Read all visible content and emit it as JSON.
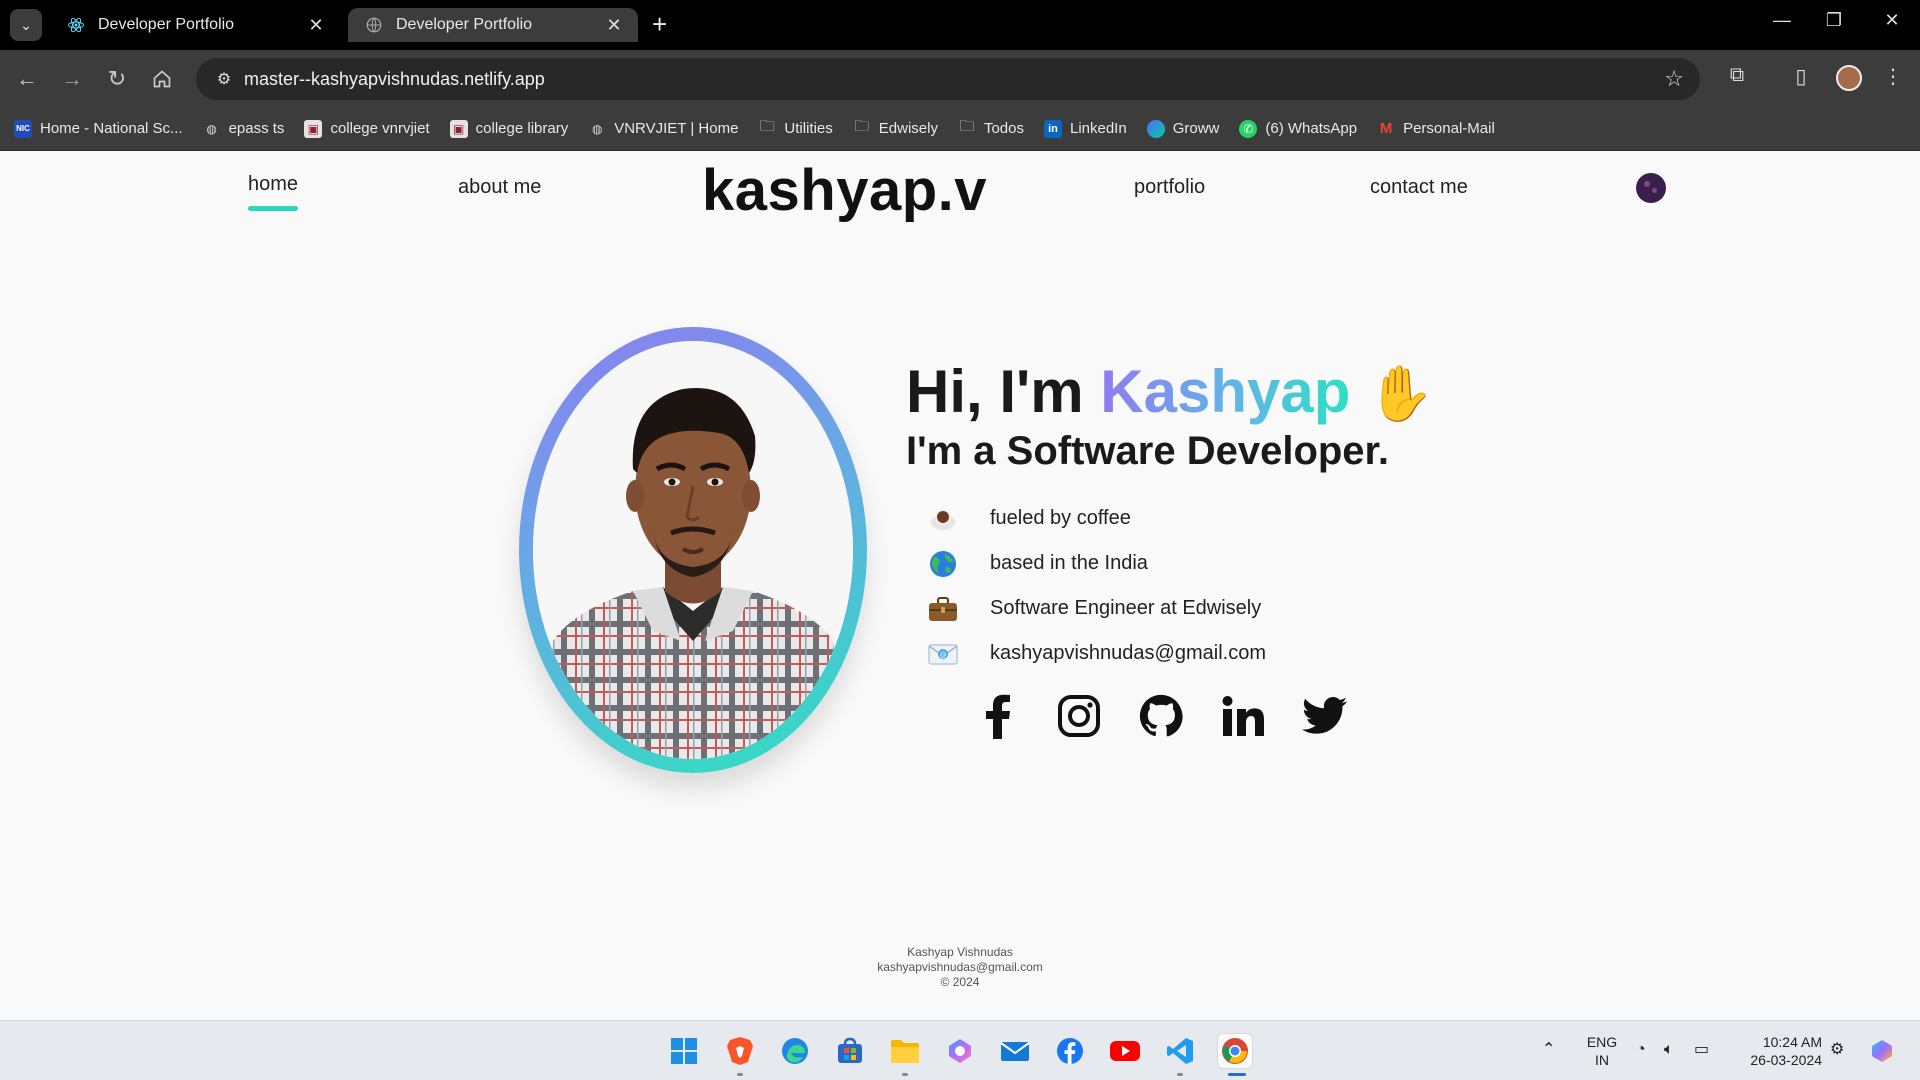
{
  "browser": {
    "tabs": [
      {
        "title": "Developer Portfolio",
        "active": false
      },
      {
        "title": "Developer Portfolio",
        "active": true
      }
    ],
    "url": "master--kashyapvishnudas.netlify.app",
    "bookmarks": [
      {
        "label": "Home - National Sc...",
        "icon": "nic-icon"
      },
      {
        "label": "epass ts",
        "icon": "globe-icon"
      },
      {
        "label": "college vnrvjiet",
        "icon": "college-icon"
      },
      {
        "label": "college library",
        "icon": "college-icon"
      },
      {
        "label": "VNRVJIET | Home",
        "icon": "globe-icon"
      },
      {
        "label": "Utilities",
        "icon": "folder-icon"
      },
      {
        "label": "Edwisely",
        "icon": "folder-icon"
      },
      {
        "label": "Todos",
        "icon": "folder-icon"
      },
      {
        "label": "LinkedIn",
        "icon": "linkedin-icon"
      },
      {
        "label": "Groww",
        "icon": "groww-icon"
      },
      {
        "label": "(6) WhatsApp",
        "icon": "whatsapp-icon"
      },
      {
        "label": "Personal-Mail",
        "icon": "gmail-icon"
      }
    ]
  },
  "nav": {
    "home": "home",
    "about": "about me",
    "brand": "kashyap.v",
    "portfolio": "portfolio",
    "contact": "contact me"
  },
  "hero": {
    "greeting": "Hi, I'm ",
    "name": "Kashyap",
    "wave": "✋",
    "subtitle": "I'm a Software Developer."
  },
  "facts": [
    {
      "icon": "coffee-icon",
      "text": "fueled by coffee"
    },
    {
      "icon": "globe-icon",
      "text": "based in the India"
    },
    {
      "icon": "briefcase-icon",
      "text": "Software Engineer at Edwisely"
    },
    {
      "icon": "email-icon",
      "text": "kashyapvishnudas@gmail.com"
    }
  ],
  "socials": [
    "facebook-icon",
    "instagram-icon",
    "github-icon",
    "linkedin-icon",
    "twitter-icon"
  ],
  "footer": {
    "name": "Kashyap Vishnudas",
    "email": "kashyapvishnudas@gmail.com",
    "copyright": "© 2024"
  },
  "taskbar": {
    "lang_top": "ENG",
    "lang_bottom": "IN",
    "time": "10:24 AM",
    "date": "26-03-2024"
  },
  "colors": {
    "accent_teal": "#2dd4bf",
    "accent_purple": "#8b7cf0",
    "text_dark": "#1a1a1a"
  }
}
